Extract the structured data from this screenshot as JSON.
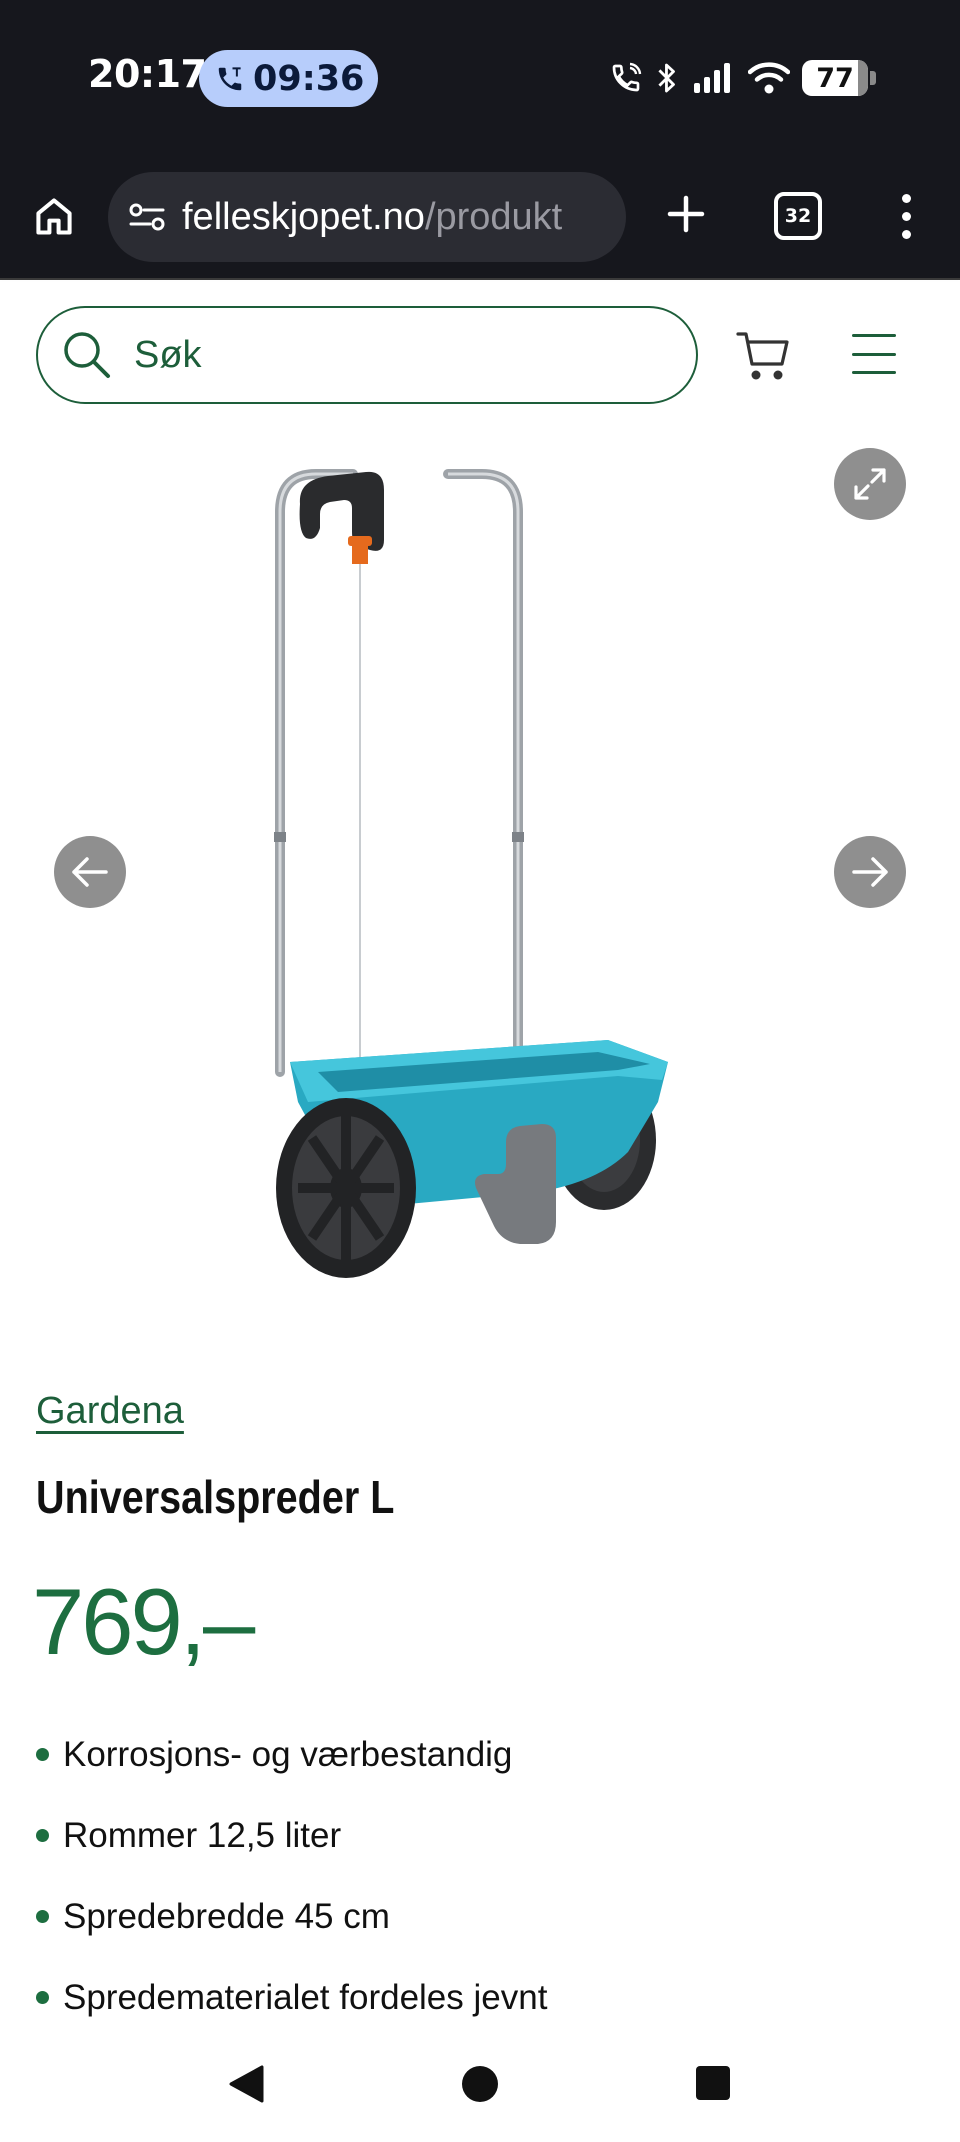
{
  "status_bar": {
    "time": "20:17",
    "call_timer": "09:36",
    "battery_level": "77",
    "icons": [
      "call-icon",
      "bluetooth-icon",
      "signal-icon",
      "wifi-icon",
      "battery-icon"
    ]
  },
  "browser": {
    "url_host": "felleskjopet.no",
    "url_path": "/produkt",
    "tab_count": "32",
    "icons": [
      "home-icon",
      "site-info-icon",
      "plus-icon",
      "tabs-icon",
      "more-vert-icon"
    ]
  },
  "header": {
    "search_placeholder": "Søk",
    "icons": [
      "search-icon",
      "cart-icon",
      "hamburger-icon"
    ],
    "accent_color": "#1d5e3a"
  },
  "gallery": {
    "icons": [
      "expand-icon",
      "arrow-left-icon",
      "arrow-right-icon"
    ]
  },
  "product": {
    "brand": "Gardena",
    "title": "Universalspreder L",
    "price": "769,–",
    "price_color": "#1d6e40",
    "features": [
      "Korrosjons- og værbestandig",
      "Rommer 12,5 liter",
      "Spredebredde 45 cm",
      "Spredematerialet fordeles jevnt"
    ]
  },
  "nav_bar": {
    "icons": [
      "back-icon",
      "home-circle-icon",
      "recents-icon"
    ]
  }
}
